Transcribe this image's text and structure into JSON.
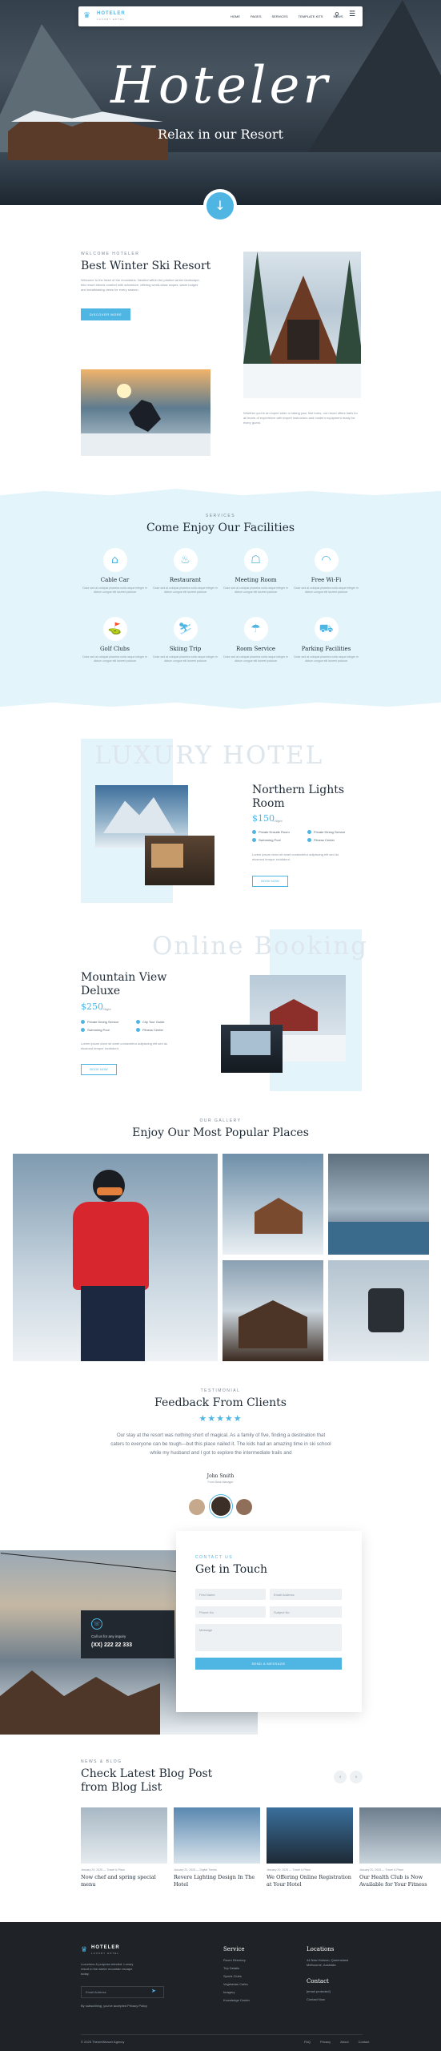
{
  "brand": {
    "name": "HOTELER",
    "tagline": "LUXURY HOTEL"
  },
  "nav": {
    "items": [
      "HOME",
      "PAGES",
      "SERVICES",
      "TEMPLATE KITS",
      "NEWS"
    ]
  },
  "hero": {
    "title": "Hoteler",
    "subtitle": "Relax in our Resort"
  },
  "intro": {
    "eyebrow": "WELCOME HOTELER",
    "title": "Best Winter Ski Resort",
    "text": "Welcome to the heart of the mountains. Nestled within the pristine winter landscape, this resort blends comfort with adventure, offering world-class slopes, warm lodges and breathtaking views for every season.",
    "button": "DISCOVER MORE",
    "caption": "Whether you're an expert skier or taking your first turns, our resort offers trails for all levels of experience with expert instructors and modern equipment ready for every guest."
  },
  "facilities": {
    "eyebrow": "SERVICES",
    "title": "Come Enjoy Our Facilities",
    "items": [
      {
        "label": "Cable Car",
        "icon": "cable-car-icon",
        "glyph": "⌂"
      },
      {
        "label": "Restaurant",
        "icon": "restaurant-icon",
        "glyph": "♨"
      },
      {
        "label": "Meeting Room",
        "icon": "meeting-room-icon",
        "glyph": "☖"
      },
      {
        "label": "Free Wi-Fi",
        "icon": "wifi-icon",
        "glyph": "◠"
      },
      {
        "label": "Golf Clubs",
        "icon": "golf-icon",
        "glyph": "⛳"
      },
      {
        "label": "Skiing Trip",
        "icon": "skiing-icon",
        "glyph": "⛷"
      },
      {
        "label": "Room Service",
        "icon": "room-service-icon",
        "glyph": "☂"
      },
      {
        "label": "Parking Facilities",
        "icon": "parking-icon",
        "glyph": "⛟"
      }
    ],
    "desc": "Dolor sed at volutpat pharetra nulla neque integer in dictum congue elit laoreet pulvinar"
  },
  "room1": {
    "watermark": "LUXURY HOTEL",
    "title": "Northern Lights Room",
    "price": "$150",
    "per": "/ Night",
    "features": [
      "Private Ensuite Room",
      "Private Dining Service",
      "Swimming Pool",
      "Fitness Center"
    ],
    "text": "Lorem ipsum dolor sit amet consectetur adipiscing elit sed do eiusmod tempor incididunt.",
    "button": "BOOK NOW"
  },
  "room2": {
    "watermark": "Online Booking",
    "title": "Mountain View Deluxe",
    "price": "$250",
    "per": "/ Night",
    "features": [
      "Private Dining Service",
      "City Tour Guide",
      "Swimming Pool",
      "Fitness Center"
    ],
    "text": "Lorem ipsum dolor sit amet consectetur adipiscing elit sed do eiusmod tempor incididunt.",
    "button": "BOOK NOW"
  },
  "gallery": {
    "eyebrow": "OUR GALLERY",
    "title": "Enjoy Our Most Popular Places"
  },
  "testimonial": {
    "eyebrow": "TESTIMONIAL",
    "title": "Feedback From Clients",
    "stars": "★★★★★",
    "quote": "Our stay at the resort was nothing short of magical. As a family of five, finding a destination that caters to everyone can be tough—but this place nailed it. The kids had an amazing time in ski school while my husband and I got to explore the intermediate trails and",
    "name": "John Smith",
    "role": "Front Desk Manager"
  },
  "contact": {
    "phone_label": "Call us for any inquiry",
    "phone": "(XX) 222 22 333",
    "eyebrow": "CONTACT US",
    "title": "Get in Touch",
    "fields": {
      "first": "First Name",
      "email": "Email Address",
      "phone": "Phone No",
      "subject": "Subject No",
      "message": "Message"
    },
    "button": "SEND A MESSAGE"
  },
  "blog": {
    "eyebrow": "NEWS & BLOG",
    "title": "Check Latest Blog Post from Blog List",
    "posts": [
      {
        "date": "January 20, 2025",
        "cat": "Travel & Place",
        "title": "Now chef and spring special menu"
      },
      {
        "date": "January 20, 2025",
        "cat": "Digital Trends",
        "title": "Revere Lighting Design In The Hotel"
      },
      {
        "date": "January 20, 2025",
        "cat": "Travel & Place",
        "title": "We Offering Online Registration at Your Hotel"
      },
      {
        "date": "January 20, 2025",
        "cat": "Travel & Place",
        "title": "Our Health Club is Now Available for Your Fitness"
      }
    ]
  },
  "footer": {
    "about": "Luxurious & purpose-minded. Luxury resort in the winter mountain escape today.",
    "newsletter_placeholder": "Email Address",
    "policy": "By subscribing, you've accepted Privacy Policy",
    "service_title": "Service",
    "services": [
      "Room Directory",
      "Trip Details",
      "Sports Clubs",
      "Vegetarian Cafes",
      "Imagery",
      "Knowledge Center"
    ],
    "location_title": "Locations",
    "address": "44 New Horizon, Queensland Melbourne, Australia",
    "contact_title": "Contact",
    "email": "[email protected]",
    "contact_link": "Contact Now",
    "copyright": "© 2025 ThemeWeaver Agency",
    "links": [
      "FAQ",
      "Privacy",
      "About",
      "Contact"
    ]
  },
  "colors": {
    "accent": "#4fb6e4",
    "light": "#e4f4fb",
    "dark": "#1f2226"
  }
}
